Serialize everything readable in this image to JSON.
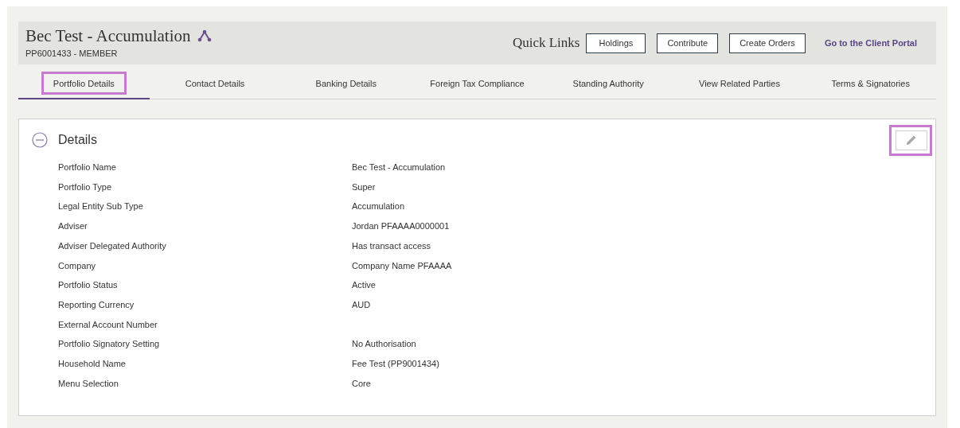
{
  "header": {
    "title": "Bec Test - Accumulation",
    "subtitle": "PP6001433 - MEMBER",
    "quick_links_label": "Quick Links",
    "quick_links": [
      "Holdings",
      "Contribute",
      "Create Orders"
    ],
    "portal_link": "Go to the Client Portal"
  },
  "tabs": [
    {
      "label": "Portfolio Details",
      "selected": true,
      "highlighted": true
    },
    {
      "label": "Contact Details",
      "selected": false,
      "highlighted": false
    },
    {
      "label": "Banking Details",
      "selected": false,
      "highlighted": false
    },
    {
      "label": "Foreign Tax Compliance",
      "selected": false,
      "highlighted": false
    },
    {
      "label": "Standing Authority",
      "selected": false,
      "highlighted": false
    },
    {
      "label": "View Related Parties",
      "selected": false,
      "highlighted": false
    },
    {
      "label": "Terms & Signatories",
      "selected": false,
      "highlighted": false
    }
  ],
  "details": {
    "title": "Details",
    "expanded": true,
    "edit_highlighted": true,
    "rows": [
      {
        "label": "Portfolio Name",
        "value": "Bec Test - Accumulation"
      },
      {
        "label": "Portfolio Type",
        "value": "Super"
      },
      {
        "label": "Legal Entity Sub Type",
        "value": "Accumulation"
      },
      {
        "label": "Adviser",
        "value": "Jordan PFAAAA0000001"
      },
      {
        "label": "Adviser Delegated Authority",
        "value": "Has transact access"
      },
      {
        "label": "Company",
        "value": "Company Name PFAAAA"
      },
      {
        "label": "Portfolio Status",
        "value": "Active"
      },
      {
        "label": "Reporting Currency",
        "value": "AUD"
      },
      {
        "label": "External Account Number"
      },
      {
        "label": "Portfolio Signatory Setting",
        "value": "No Authorisation"
      },
      {
        "label": "Household Name",
        "value": "Fee Test (PP9001434)"
      },
      {
        "label": "Menu Selection",
        "value": "Core"
      }
    ]
  }
}
